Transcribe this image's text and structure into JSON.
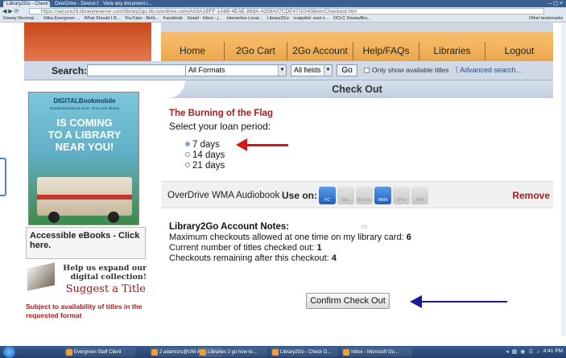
{
  "browser": {
    "tabs": [
      {
        "title": "Library2Go - Check O..."
      },
      {
        "title": "OverDrive - Device R..."
      },
      {
        "title": "View any document i..."
      }
    ],
    "window_controls": "– ◻ ×",
    "url_https": "https://",
    "url_domain": "secure29.libraryreserve.com",
    "url_path": "/library2go.lib.overdrive.com/A93A1BFF-1A6B-4EAE-889A-4258A07CDE47/10/438/en/Checkout.htm",
    "bookmarks": [
      "Dewey Decimal ...",
      "Sitka Evergreen ...",
      "What Should I R...",
      "YouTube - Birth...",
      "Facebook",
      "Gmail - Inbox - j...",
      "Interactive Local...",
      "Library2Go",
      "craigslist: east o...",
      "OCLC DeweyBro...",
      "Other bookmarks"
    ]
  },
  "nav": {
    "items": [
      "Home",
      "2Go Cart",
      "2Go Account",
      "Help/FAQs",
      "Libraries",
      "Logout"
    ]
  },
  "search": {
    "label": "Search:",
    "input_value": "",
    "format_selected": "All Formats",
    "field_selected": "All fields",
    "go_label": "Go",
    "only_available": "Only show available titles",
    "divider": "|",
    "advanced": "Advanced search..."
  },
  "sidebar": {
    "promo_brand": "DIGITALBookmobile",
    "promo_tag": "Download books & more...from your library!",
    "promo_line1": "IS COMING",
    "promo_line2": "TO A LIBRARY",
    "promo_line3": "NEAR YOU!",
    "accessible": "Accessible eBooks - Click here.",
    "help_text": "Help us expand our digital collection!",
    "suggest": "Suggest a Title",
    "subject_note": "Subject to availability of titles in the requested format"
  },
  "checkout": {
    "heading": "Check Out",
    "book_title": "The Burning of the Flag",
    "select_label": "Select your loan period:",
    "periods": [
      "7 days",
      "14 days",
      "21 days"
    ],
    "selected_period_index": 0,
    "format_name": "OverDrive WMA Audiobook",
    "use_on_label": "Use on:",
    "devices": [
      {
        "name": "PC",
        "active": true
      },
      {
        "name": "Mac",
        "active": false
      },
      {
        "name": "Burn to CD",
        "active": false
      },
      {
        "name": "WMA",
        "active": true
      },
      {
        "name": "iPod",
        "active": false
      },
      {
        "name": "MP3",
        "active": false
      }
    ],
    "remove_label": "Remove",
    "notes_title": "Library2Go Account Notes:",
    "note_max_label": "Maximum checkouts allowed at one time on my library card:",
    "note_max_value": "6",
    "note_current_label": "Current number of titles checked out:",
    "note_current_value": "1",
    "note_remaining_label": "Checkouts remaining after this checkout:",
    "note_remaining_value": "4",
    "confirm_label": "Confirm Check Out"
  },
  "annotation_colors": {
    "red_arrow": "#d01818",
    "blue_arrow": "#1a1a9a"
  },
  "taskbar": {
    "tasks": [
      "Evergreen Staff Client",
      "2 adamcirc@UM-AD...",
      "Libraries 2 go how to...",
      "Library2Go - Check O...",
      "Inbox - Microsoft Ou..."
    ],
    "clock": "4:41 PM"
  }
}
